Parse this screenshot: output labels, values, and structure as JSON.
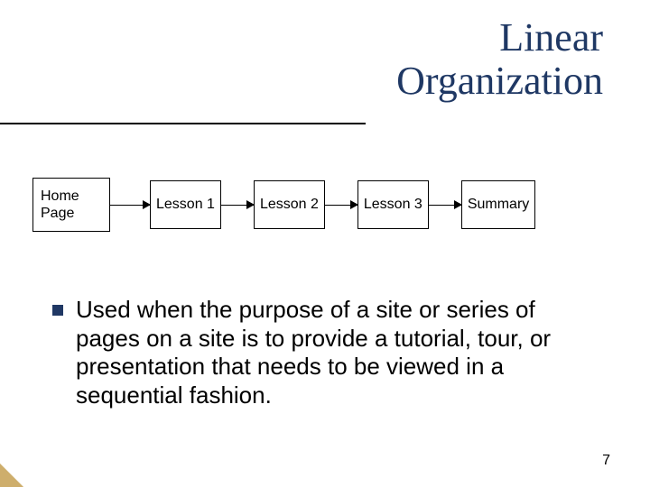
{
  "title": {
    "line1": "Linear",
    "line2": "Organization"
  },
  "diagram": {
    "nodes": [
      "Home\nPage",
      "Lesson 1",
      "Lesson 2",
      "Lesson 3",
      "Summary"
    ]
  },
  "body": {
    "para": "Used when the purpose of a site or series of pages on a site is to provide a tutorial, tour, or presentation that needs to be viewed in a sequential fashion."
  },
  "page_number": "7"
}
